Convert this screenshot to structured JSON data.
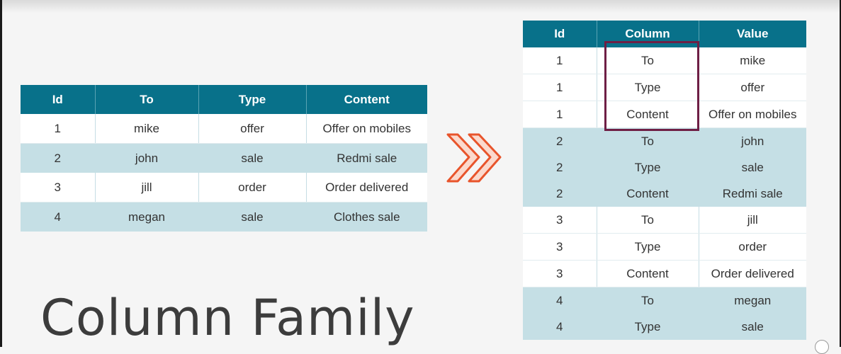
{
  "title": "Column Family",
  "colors": {
    "header_bg": "#08718a",
    "row_blue": "#c5dfe5",
    "row_white": "#ffffff",
    "arrow": "#e8542b",
    "highlight_border": "#6e1f45"
  },
  "left_table": {
    "headers": [
      "Id",
      "To",
      "Type",
      "Content"
    ],
    "rows": [
      {
        "style": "white",
        "cells": [
          "1",
          "mike",
          "offer",
          "Offer on mobiles"
        ]
      },
      {
        "style": "blue",
        "cells": [
          "2",
          "john",
          "sale",
          "Redmi sale"
        ]
      },
      {
        "style": "white",
        "cells": [
          "3",
          "jill",
          "order",
          "Order delivered"
        ]
      },
      {
        "style": "blue",
        "cells": [
          "4",
          "megan",
          "sale",
          "Clothes sale"
        ]
      }
    ]
  },
  "right_table": {
    "headers": [
      "Id",
      "Column",
      "Value"
    ],
    "rows": [
      {
        "style": "white",
        "cells": [
          "1",
          "To",
          "mike"
        ]
      },
      {
        "style": "white",
        "cells": [
          "1",
          "Type",
          "offer"
        ]
      },
      {
        "style": "white",
        "cells": [
          "1",
          "Content",
          "Offer on mobiles"
        ]
      },
      {
        "style": "blue",
        "cells": [
          "2",
          "To",
          "john"
        ]
      },
      {
        "style": "blue",
        "cells": [
          "2",
          "Type",
          "sale"
        ]
      },
      {
        "style": "blue",
        "cells": [
          "2",
          "Content",
          "Redmi sale"
        ]
      },
      {
        "style": "white",
        "cells": [
          "3",
          "To",
          "jill"
        ]
      },
      {
        "style": "white",
        "cells": [
          "3",
          "Type",
          "order"
        ]
      },
      {
        "style": "white",
        "cells": [
          "3",
          "Content",
          "Order delivered"
        ]
      },
      {
        "style": "blue",
        "cells": [
          "4",
          "To",
          "megan"
        ]
      },
      {
        "style": "blue",
        "cells": [
          "4",
          "Type",
          "sale"
        ]
      }
    ]
  },
  "icons": {
    "transform_arrow": "double-chevron-right-icon"
  }
}
